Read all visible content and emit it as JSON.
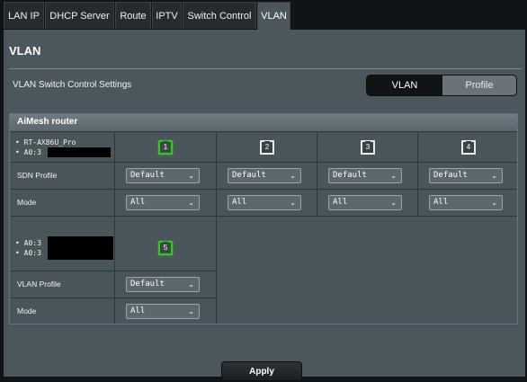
{
  "tabs": [
    {
      "label": "LAN IP"
    },
    {
      "label": "DHCP Server"
    },
    {
      "label": "Route"
    },
    {
      "label": "IPTV"
    },
    {
      "label": "Switch Control"
    },
    {
      "label": "VLAN"
    }
  ],
  "active_tab": "VLAN",
  "page": {
    "title": "VLAN",
    "switch_settings_label": "VLAN Switch Control Settings",
    "segment": {
      "vlan": "VLAN",
      "profile": "Profile",
      "selected": "VLAN"
    }
  },
  "section": {
    "header": "AiMesh router"
  },
  "device1": {
    "line1": "• RT-AX86U_Pro",
    "line2": "• A0:3"
  },
  "device2": {
    "line1": "• A0:3",
    "line2": "• A0:3"
  },
  "ports_row1": [
    {
      "label": "1",
      "active": true
    },
    {
      "label": "2",
      "active": false
    },
    {
      "label": "3",
      "active": false
    },
    {
      "label": "4",
      "active": false
    }
  ],
  "port5": {
    "label": "5",
    "active": true
  },
  "rows": {
    "sdn_profile": {
      "label": "SDN Profile",
      "values": [
        "Default",
        "Default",
        "Default",
        "Default"
      ]
    },
    "mode1": {
      "label": "Mode",
      "values": [
        "All",
        "All",
        "All",
        "All"
      ]
    },
    "vlan_profile": {
      "label": "VLAN Profile",
      "value": "Default"
    },
    "mode2": {
      "label": "Mode",
      "value": "All"
    }
  },
  "apply_label": "Apply",
  "colors": {
    "active_port": "#33c62f",
    "panel": "#4b575c"
  }
}
